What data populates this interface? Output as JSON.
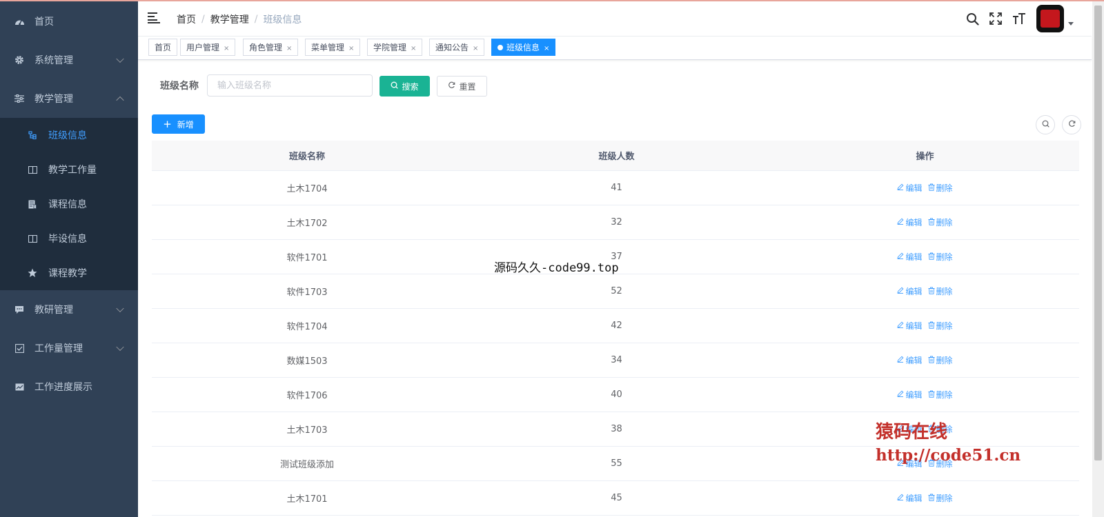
{
  "sidebar": {
    "items": [
      {
        "label": "首页",
        "icon": "dashboard-icon"
      },
      {
        "label": "系统管理",
        "icon": "gear-icon"
      },
      {
        "label": "教学管理",
        "icon": "sliders-icon"
      },
      {
        "label": "教研管理",
        "icon": "chat-icon"
      },
      {
        "label": "工作量管理",
        "icon": "checkbox-icon"
      },
      {
        "label": "工作进度展示",
        "icon": "chart-icon"
      }
    ],
    "teaching_sub": [
      {
        "label": "班级信息",
        "icon": "tree-icon"
      },
      {
        "label": "教学工作量",
        "icon": "book-icon"
      },
      {
        "label": "课程信息",
        "icon": "document-icon"
      },
      {
        "label": "毕设信息",
        "icon": "book-icon"
      },
      {
        "label": "课程教学",
        "icon": "star-icon"
      }
    ]
  },
  "breadcrumb": [
    "首页",
    "教学管理",
    "班级信息"
  ],
  "tags": [
    {
      "label": "首页"
    },
    {
      "label": "用户管理"
    },
    {
      "label": "角色管理"
    },
    {
      "label": "菜单管理"
    },
    {
      "label": "学院管理"
    },
    {
      "label": "通知公告"
    },
    {
      "label": "班级信息"
    }
  ],
  "search": {
    "label": "班级名称",
    "placeholder": "输入班级名称",
    "search_btn": "搜索",
    "reset_btn": "重置"
  },
  "toolbar": {
    "add_btn": "新增"
  },
  "table": {
    "headers": [
      "班级名称",
      "班级人数",
      "操作"
    ],
    "edit_label": "编辑",
    "delete_label": "删除",
    "rows": [
      {
        "name": "土木1704",
        "count": "41"
      },
      {
        "name": "土木1702",
        "count": "32"
      },
      {
        "name": "软件1701",
        "count": "37"
      },
      {
        "name": "软件1703",
        "count": "52"
      },
      {
        "name": "软件1704",
        "count": "42"
      },
      {
        "name": "数媒1503",
        "count": "34"
      },
      {
        "name": "软件1706",
        "count": "40"
      },
      {
        "name": "土木1703",
        "count": "38"
      },
      {
        "name": "测试班级添加",
        "count": "55"
      },
      {
        "name": "土木1701",
        "count": "45"
      }
    ]
  },
  "watermarks": {
    "center": "源码久久-code99.top",
    "brand_cn": "猿码在线",
    "brand_url": "http://code51.cn"
  },
  "colors": {
    "sidebar_bg": "#304156",
    "submenu_bg": "#1f2d3d",
    "accent": "#1890ff",
    "search_btn": "#1ab394",
    "link": "#409eff"
  }
}
